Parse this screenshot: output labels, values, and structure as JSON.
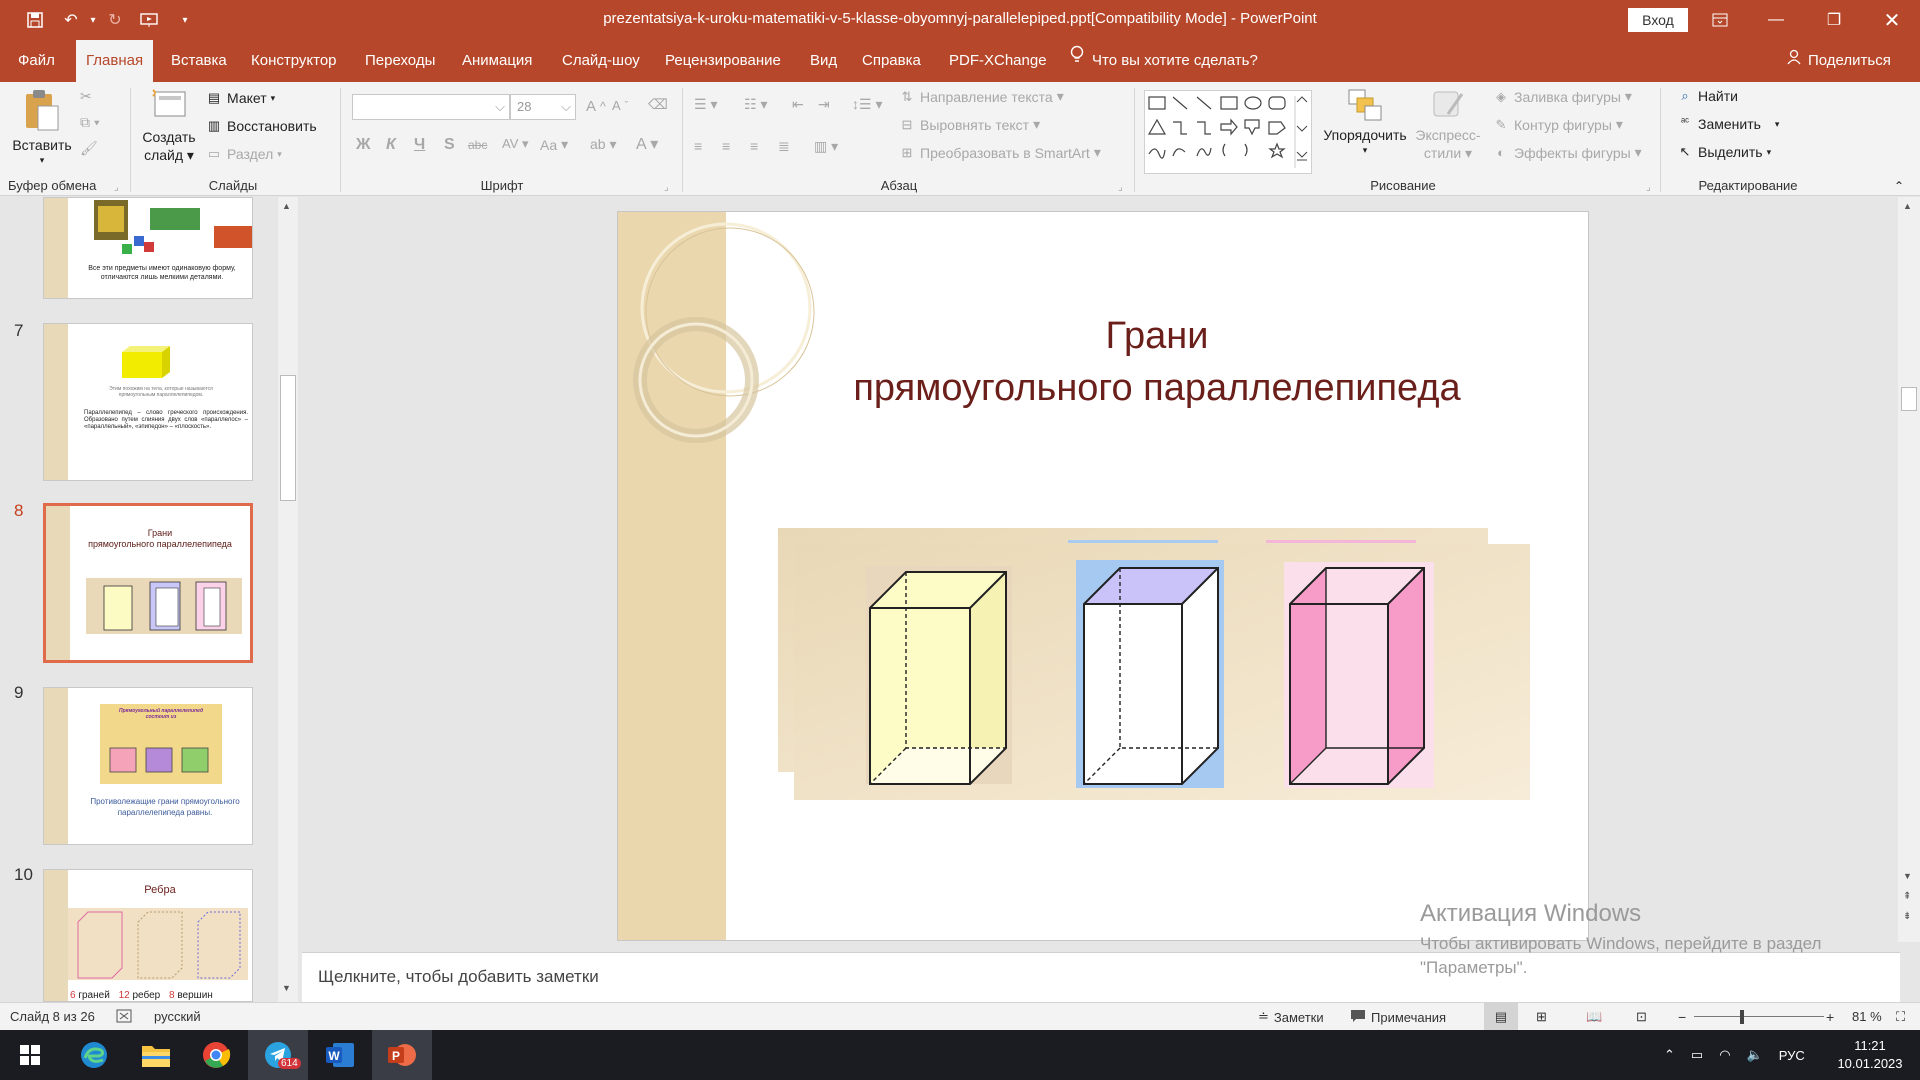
{
  "window": {
    "title": "prezentatsiya-k-uroku-matematiki-v-5-klasse-obyomnyj-parallelepiped.ppt[Compatibility Mode]  -  PowerPoint",
    "signin": "Вход"
  },
  "menu": {
    "tabs": [
      "Файл",
      "Главная",
      "Вставка",
      "Конструктор",
      "Переходы",
      "Анимация",
      "Слайд-шоу",
      "Рецензирование",
      "Вид",
      "Справка",
      "PDF-XChange"
    ],
    "tell_me": "Что вы хотите сделать?",
    "share": "Поделиться"
  },
  "ribbon": {
    "clipboard": {
      "paste": "Вставить",
      "group": "Буфер обмена"
    },
    "slides": {
      "new_slide_1": "Создать",
      "new_slide_2": "слайд",
      "layout": "Макет",
      "reset": "Восстановить",
      "section": "Раздел",
      "group": "Слайды"
    },
    "font": {
      "size": "28",
      "bold": "Ж",
      "italic": "К",
      "underline": "Ч",
      "shadow": "S",
      "strike": "abc",
      "aa": "Aa",
      "group": "Шрифт"
    },
    "paragraph": {
      "text_direction": "Направление текста",
      "align_text": "Выровнять текст",
      "smartart": "Преобразовать в SmartArt",
      "group": "Абзац"
    },
    "drawing": {
      "arrange": "Упорядочить",
      "quick_styles_1": "Экспресс-",
      "quick_styles_2": "стили",
      "fill": "Заливка фигуры",
      "outline": "Контур фигуры",
      "effects": "Эффекты фигуры",
      "group": "Рисование"
    },
    "editing": {
      "find": "Найти",
      "replace": "Заменить",
      "select": "Выделить",
      "group": "Редактирование"
    }
  },
  "thumbnails": {
    "t6": {
      "caption": "Все эти предметы имеют одинаковую форму, отличаются лишь мелкими деталями."
    },
    "t7": {
      "number": "7",
      "caption_top": "Этим похожим на тела, которые называются прямоугольным параллелепипедом.",
      "text": "Параллелепипед – слово греческого происхождения. Образовано путем слияния двух слов «параллелос» – «параллельный», «эпипедон» – «плоскость»."
    },
    "t8": {
      "number": "8",
      "title_1": "Грани",
      "title_2": "прямоугольного параллелепипеда"
    },
    "t9": {
      "number": "9",
      "header_1": "Прямоугольный параллелепипед",
      "header_2": "состоит из",
      "caption": "Противолежащие грани прямоугольного параллелепипеда равны."
    },
    "t10": {
      "number": "10",
      "title": "Ребра",
      "n1": "6",
      "l1": "граней",
      "n2": "12",
      "l2": "ребер",
      "n3": "8",
      "l3": "вершин"
    }
  },
  "slide": {
    "title_1": "Грани",
    "title_2": "прямоугольного параллелепипеда"
  },
  "notes": {
    "placeholder": "Щелкните, чтобы добавить заметки"
  },
  "watermark": {
    "line1": "Активация Windows",
    "line2": "Чтобы активировать Windows, перейдите в раздел",
    "line3": "\"Параметры\"."
  },
  "status": {
    "slide_info": "Слайд 8 из 26",
    "language": "русский",
    "notes": "Заметки",
    "comments": "Примечания",
    "zoom": "81 %"
  },
  "taskbar": {
    "telegram_badge": "614",
    "lang": "РУС",
    "time": "11:21",
    "date": "10.01.2023"
  },
  "colors": {
    "accent": "#b7472a",
    "title_text": "#6b1f1a",
    "slide_band": "#ead7ad"
  }
}
